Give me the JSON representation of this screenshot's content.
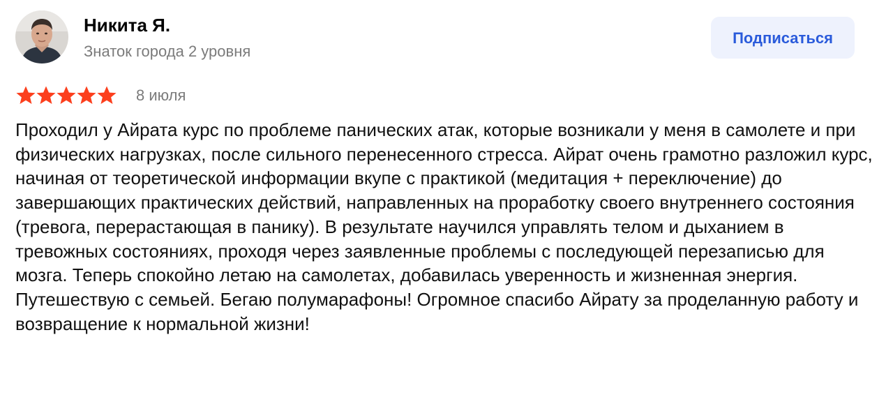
{
  "author": {
    "name": "Никита Я.",
    "level": "Знаток города 2 уровня"
  },
  "subscribe_button": {
    "label": "Подписаться"
  },
  "rating": {
    "stars": 5,
    "max": 5,
    "date": "8 июля"
  },
  "review_text": "Проходил у Айрата курс по проблеме панических атак, которые возникали у меня в самолете и при физических нагрузках, после сильного перенесенного стресса. Айрат очень грамотно разложил курс, начиная от теоретической информации вкупе с практикой (медитация + переключение) до завершающих практических действий, направленных на проработку своего внутреннего состояния (тревога, перерастающая в панику). В результате научился управлять телом и дыханием в тревожных состояниях, проходя через заявленные проблемы с последующей перезаписью для мозга. Теперь спокойно летаю на самолетах, добавилась уверенность и жизненная энергия. Путешествую с семьей. Бегаю полумарафоны! Огромное спасибо Айрату за проделанную работу и возвращение к нормальной жизни!",
  "colors": {
    "star": "#fc3f1d",
    "accent": "#2a5bdb",
    "button_bg": "#eef2fd",
    "secondary_text": "#7b7b7b"
  }
}
